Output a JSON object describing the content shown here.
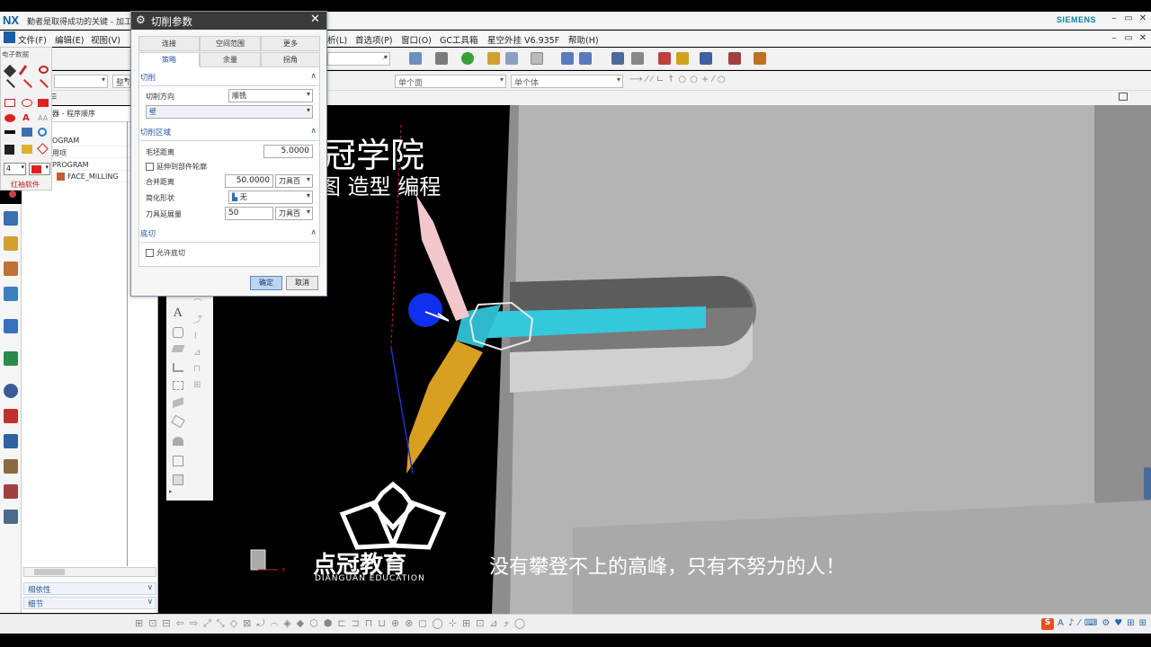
{
  "window": {
    "app_logo": "NX",
    "title": "勤者是取得成功的关键 - 加工 - ",
    "brand": "SIEMENS",
    "controls": [
      "–",
      "▭",
      "✕"
    ]
  },
  "menubar": {
    "items": [
      "文件(F)",
      "编辑(E)",
      "视图(V)",
      "析(L)",
      "首选项(P)",
      "窗口(O)",
      "GC工具箱",
      "星空外挂 V6.935F",
      "帮助(H)"
    ]
  },
  "toolbar": {
    "filter_1": "单个面",
    "filter_2": "单个体",
    "combo_left_1": "",
    "combo_left_2": "整个"
  },
  "palette": {
    "title": "电子数据",
    "line_width": "4"
  },
  "navigator": {
    "header_1": "器 - 程序顺序",
    "rows": [
      "OGRAM",
      "用项",
      "PROGRAM",
      "FACE_MILLING"
    ],
    "section_1": "相依性",
    "section_2": "细节",
    "watermark_tag": "红袖软件"
  },
  "dialog": {
    "title": "切削参数",
    "tabs_row1": [
      "连接",
      "空间范围",
      "更多"
    ],
    "tabs_row2": [
      "策略",
      "余量",
      "拐角"
    ],
    "group_cut": {
      "header": "切削",
      "direction_label": "切削方向",
      "direction_value": "顺铣",
      "wall_value": "壁"
    },
    "group_region": {
      "header": "切削区域",
      "stock_label": "毛坯距离",
      "stock_value": "5.0000",
      "extend_label": "延伸到部件轮廓",
      "merge_label": "合并距离",
      "merge_value": "50.0000",
      "merge_unit": "刀具百",
      "simplify_label": "简化形状",
      "simplify_value": "无",
      "extend_dist_label": "刀具延展量",
      "extend_dist_value": "50",
      "extend_dist_unit": "刀具百"
    },
    "group_undercut": {
      "header": "底切",
      "allow_label": "允许底切"
    },
    "ok_label": "确定",
    "cancel_label": "取消"
  },
  "graphics": {
    "watermark_top": "冠学院",
    "watermark_sub": "图 造型 编程",
    "logo_text": "点冠教育",
    "logo_en": "DIANGUAN EDUCATION",
    "slogan": "没有攀登不上的高峰，只有不努力的人！",
    "axis_x": "x"
  },
  "colors": {
    "accent": "#2a5a9a",
    "toolpath": "#2fd0e0",
    "toolpath_2": "#e8a020",
    "part": "#c8c8c8"
  }
}
